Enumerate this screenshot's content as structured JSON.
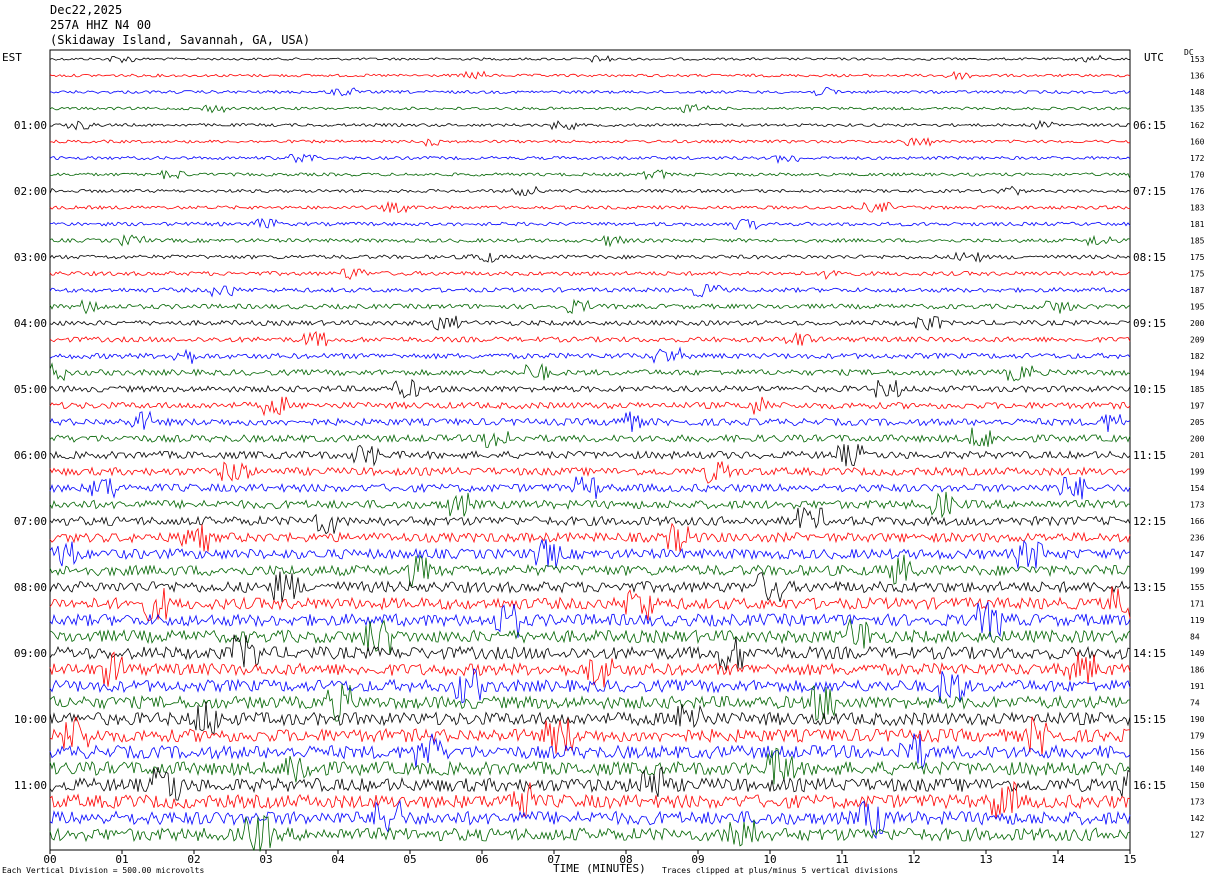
{
  "header": {
    "date": "Dec22,2025",
    "station": "257A HHZ N4 00",
    "location": "(Skidaway Island, Savannah, GA, USA)"
  },
  "timezones": {
    "left": "EST",
    "right": "UTC",
    "dc": "DC"
  },
  "footer": {
    "division": "Each Vertical Division = 500.00 microvolts",
    "time_label": "TIME (MINUTES)",
    "clip_note": "Traces clipped at plus/minus 5 vertical divisions"
  },
  "colors": {
    "cycle": [
      "#000000",
      "#ff0000",
      "#0000ff",
      "#006400"
    ]
  },
  "chart_data": {
    "type": "line",
    "title": "Dec22,2025 257A HHZ N4 00 (Skidaway Island, Savannah, GA, USA)",
    "xlabel": "TIME (MINUTES)",
    "x_ticks": [
      "00",
      "01",
      "02",
      "03",
      "04",
      "05",
      "06",
      "07",
      "08",
      "09",
      "10",
      "11",
      "12",
      "13",
      "14",
      "15"
    ],
    "xlim": [
      0,
      15
    ],
    "est_labels": [
      "01:00",
      "02:00",
      "03:00",
      "04:00",
      "05:00",
      "06:00",
      "07:00",
      "08:00",
      "09:00",
      "10:00",
      "11:00"
    ],
    "utc_labels": [
      "06:15",
      "07:15",
      "08:15",
      "09:15",
      "10:15",
      "11:15",
      "12:15",
      "13:15",
      "14:15",
      "15:15",
      "16:15"
    ],
    "dc_offsets": [
      153,
      136,
      148,
      135,
      162,
      160,
      172,
      170,
      176,
      183,
      181,
      185,
      175,
      175,
      187,
      195,
      200,
      209,
      182,
      194,
      185,
      197,
      205,
      200,
      201,
      199,
      154,
      173,
      166,
      236,
      147,
      199,
      155,
      171,
      119,
      84,
      149,
      186,
      191,
      74,
      190,
      179,
      156,
      140,
      150,
      173,
      142,
      127
    ],
    "trace_count": 48,
    "amplitude_profile": [
      0.25,
      0.28,
      0.3,
      0.28,
      0.3,
      0.3,
      0.32,
      0.32,
      0.33,
      0.35,
      0.37,
      0.38,
      0.4,
      0.42,
      0.45,
      0.48,
      0.5,
      0.52,
      0.55,
      0.58,
      0.62,
      0.65,
      0.7,
      0.72,
      0.75,
      0.78,
      0.8,
      0.85,
      0.9,
      0.95,
      1.0,
      1.05,
      1.1,
      1.15,
      1.2,
      1.25,
      1.25,
      1.2,
      1.2,
      1.25,
      1.3,
      1.3,
      1.3,
      1.35,
      1.35,
      1.35,
      1.35,
      1.3
    ],
    "grid": false
  }
}
